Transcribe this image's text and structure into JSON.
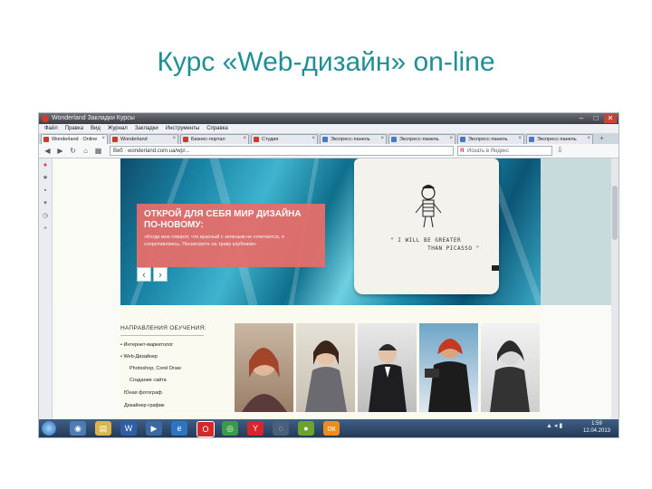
{
  "slide": {
    "title": "Курс «Web-дизайн» on-line"
  },
  "browser": {
    "title_text": "Wonderland  Закладки  Курсы",
    "window_controls": {
      "minimize": "–",
      "maximize": "□",
      "close": "✕"
    },
    "menu": [
      "Файл",
      "Правка",
      "Вид",
      "Журнал",
      "Закладки",
      "Инструменты",
      "Справка"
    ],
    "tabs": [
      {
        "label": "Wonderland · Online"
      },
      {
        "label": "Wonderland"
      },
      {
        "label": "Бизнес-портал"
      },
      {
        "label": "Студия"
      },
      {
        "label": "Экспресс-панель"
      },
      {
        "label": "Экспресс-панель"
      },
      {
        "label": "Экспресс-панель"
      },
      {
        "label": "Экспресс-панель"
      }
    ],
    "url": "Веб  ·  wonderland.com.ua/wp/...",
    "search_placeholder": "Искать в Яндекс",
    "search_logo": "Я"
  },
  "hero": {
    "heading": "ОТКРОЙ ДЛЯ СЕБЯ МИР ДИЗАЙНА ПО-НОВОМУ:",
    "text": "«Когда мне говорят, что красный с зеленым не сочетается, я сопротивляюсь. Посмотрите на траву клубники»",
    "prev_arrow": "‹",
    "next_arrow": "›",
    "pillow_quote": "\" I WILL BE GREATER\n          THAN PICASSO \""
  },
  "directions": {
    "title": "НАПРАВЛЕНИЯ ОБУЧЕНИЯ:",
    "items": [
      "• Интернет-маркетолог",
      "• Web-Дизайнер",
      "Photoshop, Corel Draw",
      "Создание сайта",
      "Юная фотограф",
      "Дизайнер-график"
    ]
  },
  "photos": [
    {
      "name": "teacher-woman-red-hair"
    },
    {
      "name": "teacher-woman-dark-hair"
    },
    {
      "name": "teacher-man-suit"
    },
    {
      "name": "teacher-man-camera"
    },
    {
      "name": "teacher-man-bw"
    }
  ],
  "taskbar": {
    "time": "1:59",
    "date": "12.04.2013",
    "tray": "▲ ◂ ▮"
  },
  "colors": {
    "title": "#1f8f96",
    "promo": "#e56e6a",
    "taskbar": "#2d4a6e"
  }
}
